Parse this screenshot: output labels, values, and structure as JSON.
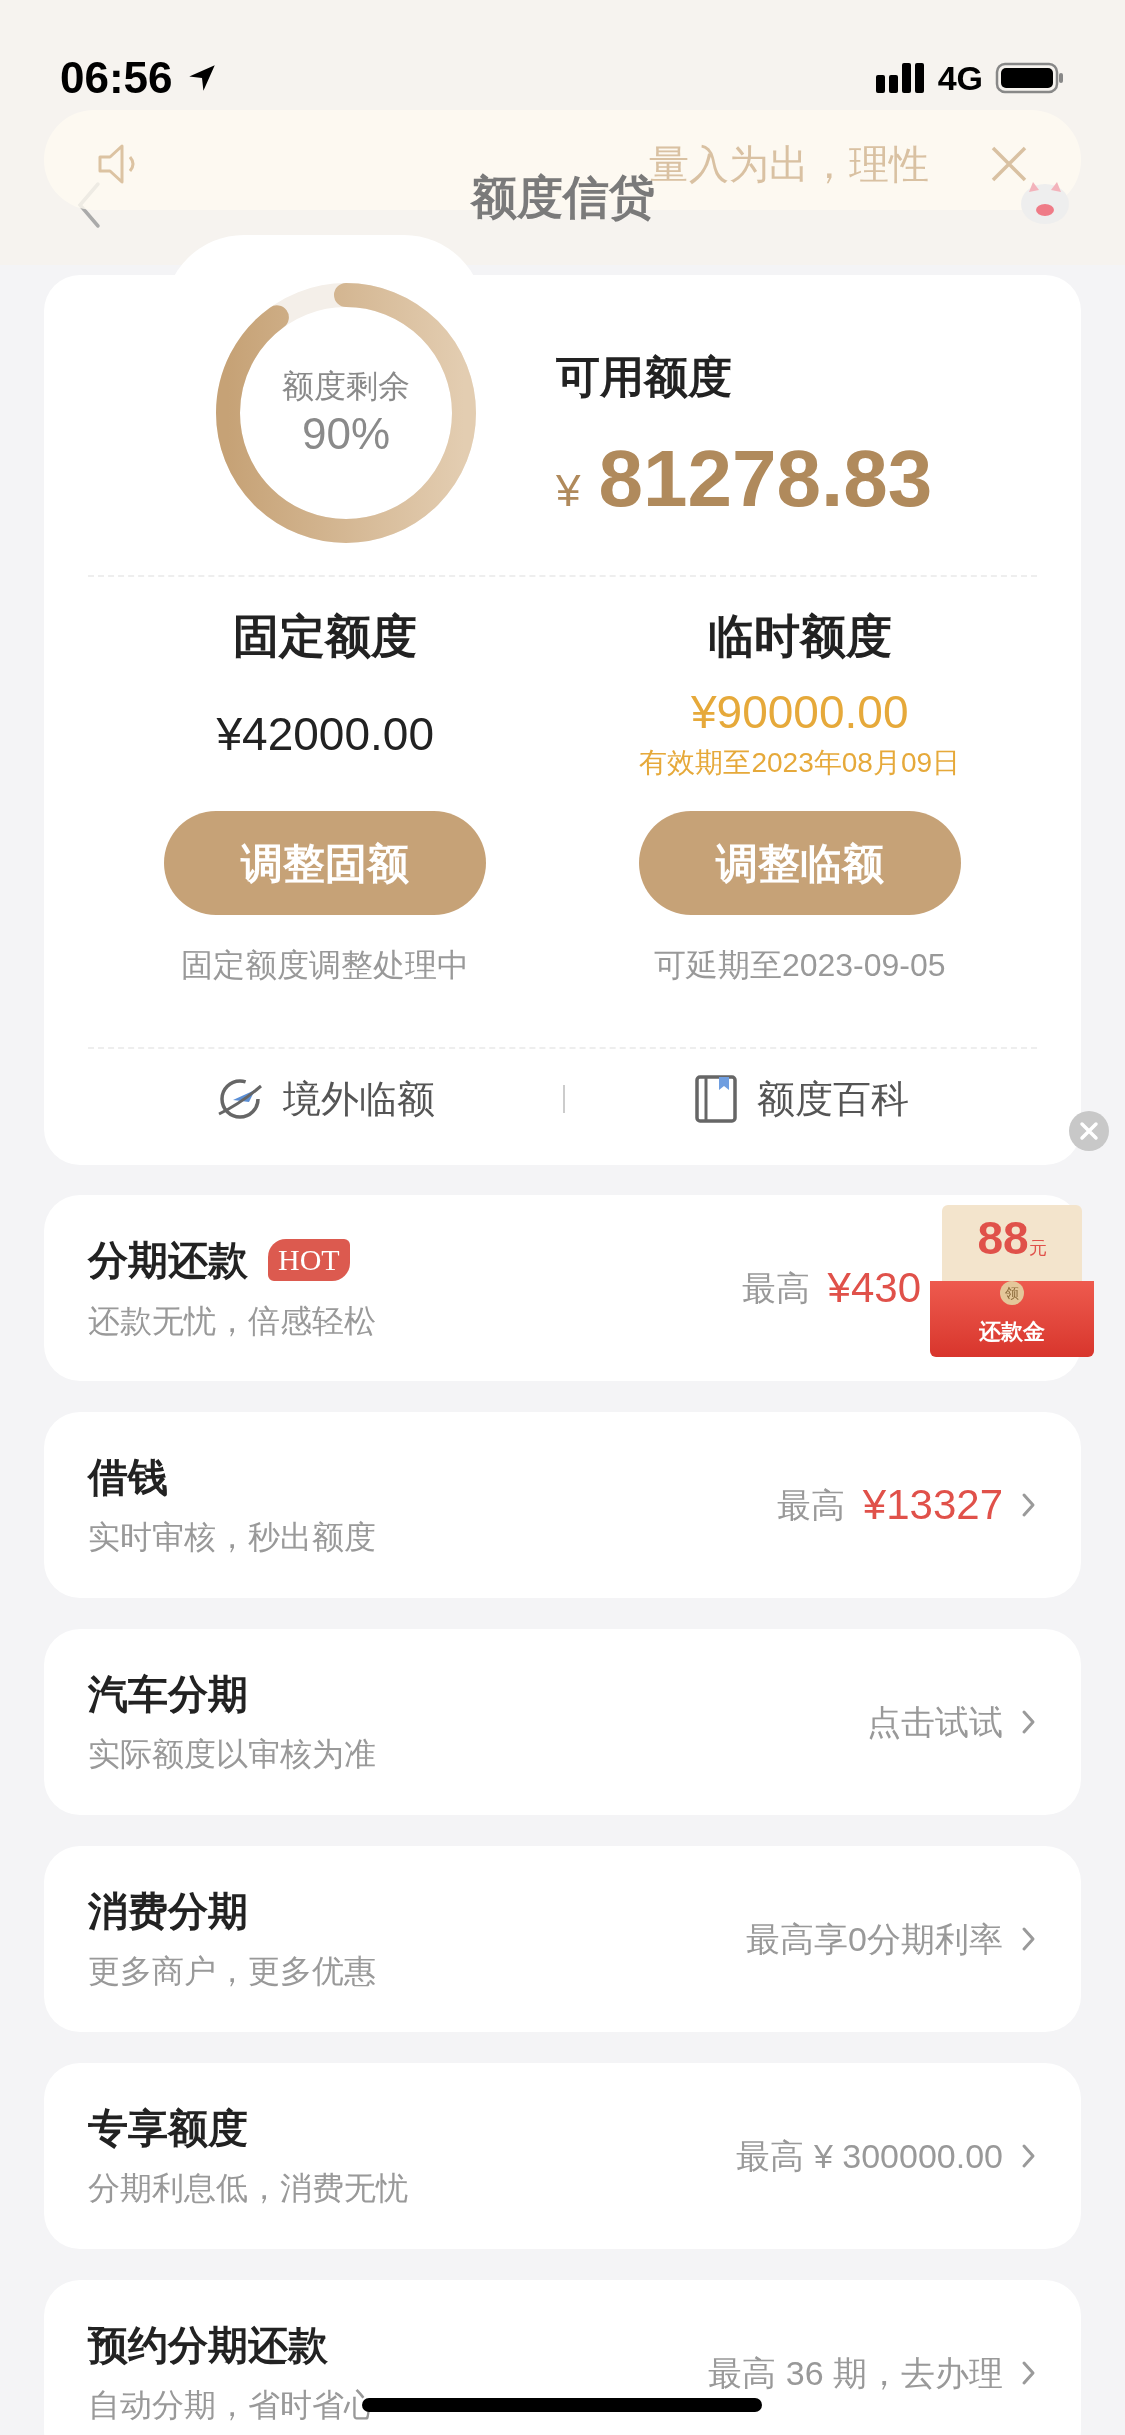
{
  "status_bar": {
    "time": "06:56",
    "network": "4G"
  },
  "notice": {
    "text": "量入为出，理性"
  },
  "header": {
    "title": "额度信贷"
  },
  "summary": {
    "ring_label": "额度剩余",
    "ring_value": "90%",
    "available_label": "可用额度",
    "currency": "¥",
    "available_amount": "81278.83"
  },
  "quotas": [
    {
      "title": "固定额度",
      "amount": "¥42000.00",
      "kind": "fixed",
      "button": "调整固额",
      "note": "固定额度调整处理中"
    },
    {
      "title": "临时额度",
      "amount": "¥90000.00",
      "kind": "temporary",
      "validity": "有效期至2023年08月09日",
      "button": "调整临额",
      "note": "可延期至2023-09-05"
    }
  ],
  "links": [
    {
      "label": "境外临额",
      "kind": "plane"
    },
    {
      "label": "额度百科",
      "kind": "book"
    }
  ],
  "services": [
    {
      "title": "分期还款",
      "badge": "HOT",
      "subtitle": "还款无忧，倍感轻松",
      "right_label": "最高",
      "amount": "¥430"
    },
    {
      "title": "借钱",
      "subtitle": "实时审核，秒出额度",
      "right_label": "最高",
      "amount": "¥13327"
    },
    {
      "title": "汽车分期",
      "subtitle": "实际额度以审核为准",
      "right_label": "点击试试"
    },
    {
      "title": "消费分期",
      "subtitle": "更多商户，更多优惠",
      "right_label": "最高享0分期利率"
    },
    {
      "title": "专享额度",
      "subtitle": "分期利息低，消费无忧",
      "right_label": "最高 ¥ 300000.00"
    },
    {
      "title": "预约分期还款",
      "subtitle": "自动分期，省时省心",
      "right_label": "最高 36 期，去办理"
    }
  ],
  "red_packet": {
    "amount": "88",
    "unit": "元",
    "stamp": "领",
    "label": "还款金"
  }
}
